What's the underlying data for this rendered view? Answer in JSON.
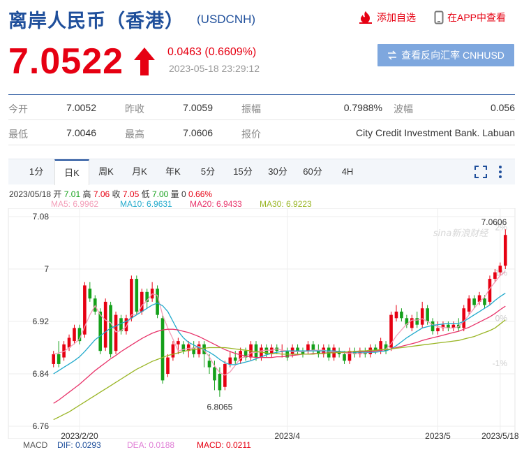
{
  "header": {
    "title": "离岸人民币（香港）",
    "code": "(USDCNH)",
    "add_label": "添加自选",
    "app_label": "在APP中查看"
  },
  "quote": {
    "price": "7.0522",
    "change": "0.0463 (0.6609%)",
    "time": "2023-05-18 23:29:12",
    "reverse_label": "查看反向汇率 CNHUSD"
  },
  "stats": {
    "row1": [
      {
        "label": "今开",
        "value": "7.0052"
      },
      {
        "label": "昨收",
        "value": "7.0059"
      },
      {
        "label": "振幅",
        "value": "0.7988%"
      },
      {
        "label": "波幅",
        "value": "0.056"
      }
    ],
    "row2": [
      {
        "label": "最低",
        "value": "7.0046"
      },
      {
        "label": "最高",
        "value": "7.0606"
      },
      {
        "label": "报价",
        "value": "City Credit Investment Bank. Labuan"
      }
    ]
  },
  "tabs": [
    "1分",
    "日K",
    "周K",
    "月K",
    "年K",
    "5分",
    "15分",
    "30分",
    "60分",
    "4H"
  ],
  "active_tab": 1,
  "info_line": {
    "date": "2023/05/18",
    "open": {
      "label": "开",
      "value": "7.01"
    },
    "high": {
      "label": "高",
      "value": "7.06"
    },
    "close": {
      "label": "收",
      "value": "7.05"
    },
    "low": {
      "label": "低",
      "value": "7.00"
    },
    "volume": {
      "label": "量",
      "value": "0"
    },
    "pct": "0.66%"
  },
  "ma_legend": [
    {
      "label": "MA5: 6.9962",
      "color": "#f39eb8"
    },
    {
      "label": "MA10: 6.9631",
      "color": "#22aacc"
    },
    {
      "label": "MA20: 6.9433",
      "color": "#e8336a"
    },
    {
      "label": "MA30: 6.9223",
      "color": "#99b524"
    }
  ],
  "macd": {
    "title": "MACD",
    "dif": "DIF: 0.0293",
    "dea": "DEA: 0.0188",
    "macd": "MACD: 0.0211"
  },
  "watermark": "sina新浪财经",
  "colors": {
    "up": "#e60012",
    "down": "#14a01a",
    "brand": "#1f4f9b"
  },
  "chart_data": {
    "type": "candlestick",
    "ylim": [
      6.76,
      7.08
    ],
    "y_ticks": [
      "7.08",
      "7",
      "6.92",
      "6.84",
      "6.76"
    ],
    "y_tick_values": [
      7.08,
      7.0,
      6.92,
      6.84,
      6.76
    ],
    "pct_ticks": [
      "2%",
      "1%",
      "0%",
      "-1%"
    ],
    "pct_tick_values": [
      2,
      1,
      0,
      -1
    ],
    "pct_base": 6.925,
    "x_ticks": [
      {
        "label": "2023/2/20",
        "index": 5
      },
      {
        "label": "2023/4",
        "index": 45
      },
      {
        "label": "2023/5",
        "index": 74
      },
      {
        "label": "2023/5/18",
        "index": 86
      }
    ],
    "annotations": [
      {
        "text": "7.0606",
        "index": 87,
        "value": 7.0606
      },
      {
        "text": "6.8065",
        "index": 32,
        "value": 6.8065
      }
    ],
    "candles": [
      [
        6.855,
        6.87,
        6.85,
        6.875
      ],
      [
        6.87,
        6.855,
        6.85,
        6.89
      ],
      [
        6.865,
        6.885,
        6.86,
        6.89
      ],
      [
        6.88,
        6.895,
        6.875,
        6.9
      ],
      [
        6.89,
        6.91,
        6.885,
        6.915
      ],
      [
        6.91,
        6.89,
        6.885,
        6.915
      ],
      [
        6.9,
        6.975,
        6.895,
        6.98
      ],
      [
        6.97,
        6.955,
        6.95,
        6.98
      ],
      [
        6.955,
        6.935,
        6.93,
        6.96
      ],
      [
        6.935,
        6.875,
        6.87,
        6.94
      ],
      [
        6.88,
        6.95,
        6.875,
        6.955
      ],
      [
        6.945,
        6.87,
        6.865,
        6.95
      ],
      [
        6.875,
        6.93,
        6.87,
        6.935
      ],
      [
        6.925,
        6.905,
        6.9,
        6.93
      ],
      [
        6.905,
        6.925,
        6.9,
        6.93
      ],
      [
        6.925,
        6.985,
        6.92,
        6.99
      ],
      [
        6.985,
        6.935,
        6.93,
        6.99
      ],
      [
        6.935,
        6.965,
        6.93,
        6.97
      ],
      [
        6.965,
        6.95,
        6.94,
        6.97
      ],
      [
        6.955,
        6.97,
        6.95,
        6.98
      ],
      [
        6.97,
        6.93,
        6.925,
        6.975
      ],
      [
        6.925,
        6.83,
        6.825,
        6.93
      ],
      [
        6.84,
        6.865,
        6.835,
        6.87
      ],
      [
        6.865,
        6.885,
        6.86,
        6.89
      ],
      [
        6.885,
        6.89,
        6.87,
        6.895
      ],
      [
        6.885,
        6.875,
        6.87,
        6.89
      ],
      [
        6.875,
        6.885,
        6.865,
        6.89
      ],
      [
        6.88,
        6.87,
        6.865,
        6.89
      ],
      [
        6.87,
        6.885,
        6.865,
        6.89
      ],
      [
        6.885,
        6.87,
        6.85,
        6.89
      ],
      [
        6.86,
        6.85,
        6.84,
        6.87
      ],
      [
        6.85,
        6.83,
        6.815,
        6.86
      ],
      [
        6.84,
        6.815,
        6.805,
        6.85
      ],
      [
        6.82,
        6.855,
        6.815,
        6.86
      ],
      [
        6.855,
        6.865,
        6.85,
        6.875
      ],
      [
        6.865,
        6.86,
        6.855,
        6.875
      ],
      [
        6.86,
        6.875,
        6.855,
        6.88
      ],
      [
        6.875,
        6.865,
        6.86,
        6.88
      ],
      [
        6.865,
        6.885,
        6.86,
        6.89
      ],
      [
        6.885,
        6.865,
        6.86,
        6.89
      ],
      [
        6.865,
        6.88,
        6.86,
        6.885
      ],
      [
        6.88,
        6.87,
        6.865,
        6.885
      ],
      [
        6.87,
        6.88,
        6.865,
        6.885
      ],
      [
        6.88,
        6.875,
        6.87,
        6.885
      ],
      [
        6.875,
        6.875,
        6.865,
        6.885
      ],
      [
        6.875,
        6.865,
        6.86,
        6.88
      ],
      [
        6.87,
        6.88,
        6.865,
        6.885
      ],
      [
        6.88,
        6.875,
        6.87,
        6.885
      ],
      [
        6.875,
        6.87,
        6.865,
        6.88
      ],
      [
        6.875,
        6.885,
        6.87,
        6.89
      ],
      [
        6.885,
        6.875,
        6.87,
        6.89
      ],
      [
        6.875,
        6.87,
        6.865,
        6.885
      ],
      [
        6.87,
        6.88,
        6.865,
        6.885
      ],
      [
        6.88,
        6.865,
        6.86,
        6.885
      ],
      [
        6.865,
        6.88,
        6.86,
        6.885
      ],
      [
        6.875,
        6.87,
        6.865,
        6.88
      ],
      [
        6.87,
        6.86,
        6.855,
        6.875
      ],
      [
        6.86,
        6.875,
        6.855,
        6.88
      ],
      [
        6.875,
        6.87,
        6.865,
        6.88
      ],
      [
        6.87,
        6.875,
        6.865,
        6.88
      ],
      [
        6.875,
        6.87,
        6.865,
        6.88
      ],
      [
        6.87,
        6.88,
        6.865,
        6.885
      ],
      [
        6.88,
        6.875,
        6.87,
        6.885
      ],
      [
        6.875,
        6.89,
        6.87,
        6.895
      ],
      [
        6.885,
        6.875,
        6.87,
        6.89
      ],
      [
        6.88,
        6.93,
        6.875,
        6.935
      ],
      [
        6.925,
        6.935,
        6.92,
        6.945
      ],
      [
        6.935,
        6.925,
        6.92,
        6.94
      ],
      [
        6.925,
        6.915,
        6.91,
        6.93
      ],
      [
        6.91,
        6.925,
        6.905,
        6.93
      ],
      [
        6.925,
        6.915,
        6.91,
        6.935
      ],
      [
        6.915,
        6.94,
        6.91,
        6.95
      ],
      [
        6.94,
        6.92,
        6.915,
        6.945
      ],
      [
        6.92,
        6.905,
        6.9,
        6.925
      ],
      [
        6.905,
        6.91,
        6.9,
        6.92
      ],
      [
        6.91,
        6.915,
        6.905,
        6.92
      ],
      [
        6.915,
        6.91,
        6.905,
        6.92
      ],
      [
        6.91,
        6.915,
        6.905,
        6.92
      ],
      [
        6.915,
        6.91,
        6.905,
        6.925
      ],
      [
        6.91,
        6.94,
        6.905,
        6.945
      ],
      [
        6.935,
        6.955,
        6.93,
        6.96
      ],
      [
        6.955,
        6.945,
        6.94,
        6.96
      ],
      [
        6.95,
        6.96,
        6.945,
        6.965
      ],
      [
        6.955,
        6.945,
        6.94,
        6.96
      ],
      [
        6.95,
        6.985,
        6.945,
        6.99
      ],
      [
        6.985,
        6.995,
        6.98,
        7.0
      ],
      [
        6.995,
        7.005,
        6.99,
        7.01
      ],
      [
        7.005,
        7.052,
        7.0,
        7.0606
      ]
    ],
    "ma": {
      "MA5": [
        6.87,
        6.872,
        6.874,
        6.88,
        6.886,
        6.893,
        6.912,
        6.93,
        6.944,
        6.93,
        6.922,
        6.918,
        6.904,
        6.906,
        6.912,
        6.93,
        6.93,
        6.944,
        6.952,
        6.962,
        6.96,
        6.93,
        6.91,
        6.893,
        6.875,
        6.877,
        6.879,
        6.879,
        6.882,
        6.876,
        6.866,
        6.852,
        6.842,
        6.838,
        6.843,
        6.853,
        6.864,
        6.866,
        6.872,
        6.873,
        6.875,
        6.876,
        6.876,
        6.878,
        6.876,
        6.875,
        6.874,
        6.874,
        6.874,
        6.875,
        6.876,
        6.876,
        6.876,
        6.874,
        6.874,
        6.873,
        6.872,
        6.871,
        6.871,
        6.871,
        6.872,
        6.873,
        6.874,
        6.876,
        6.878,
        6.886,
        6.898,
        6.907,
        6.916,
        6.922,
        6.922,
        6.924,
        6.92,
        6.915,
        6.912,
        6.911,
        6.91,
        6.91,
        6.912,
        6.92,
        6.93,
        6.94,
        6.95,
        6.957,
        6.97,
        6.98,
        6.99,
        6.9962
      ],
      "MA10": [
        6.84,
        6.845,
        6.85,
        6.855,
        6.86,
        6.866,
        6.874,
        6.883,
        6.892,
        6.898,
        6.904,
        6.91,
        6.913,
        6.917,
        6.92,
        6.925,
        6.93,
        6.935,
        6.94,
        6.945,
        6.948,
        6.944,
        6.935,
        6.92,
        6.905,
        6.895,
        6.888,
        6.884,
        6.88,
        6.877,
        6.873,
        6.868,
        6.862,
        6.857,
        6.854,
        6.854,
        6.856,
        6.858,
        6.86,
        6.863,
        6.866,
        6.869,
        6.871,
        6.873,
        6.874,
        6.875,
        6.875,
        6.875,
        6.875,
        6.875,
        6.875,
        6.875,
        6.875,
        6.875,
        6.875,
        6.874,
        6.874,
        6.873,
        6.873,
        6.873,
        6.873,
        6.873,
        6.873,
        6.874,
        6.875,
        6.878,
        6.883,
        6.889,
        6.895,
        6.9,
        6.905,
        6.91,
        6.912,
        6.914,
        6.915,
        6.916,
        6.917,
        6.917,
        6.917,
        6.92,
        6.925,
        6.93,
        6.935,
        6.94,
        6.945,
        6.952,
        6.958,
        6.9631
      ],
      "MA20": [
        6.795,
        6.8,
        6.806,
        6.812,
        6.818,
        6.824,
        6.831,
        6.838,
        6.845,
        6.851,
        6.857,
        6.863,
        6.868,
        6.874,
        6.879,
        6.884,
        6.889,
        6.894,
        6.898,
        6.902,
        6.905,
        6.907,
        6.908,
        6.908,
        6.907,
        6.905,
        6.903,
        6.9,
        6.897,
        6.893,
        6.889,
        6.885,
        6.881,
        6.877,
        6.874,
        6.871,
        6.869,
        6.867,
        6.866,
        6.865,
        6.865,
        6.865,
        6.865,
        6.866,
        6.866,
        6.867,
        6.868,
        6.869,
        6.87,
        6.87,
        6.871,
        6.871,
        6.872,
        6.872,
        6.873,
        6.873,
        6.873,
        6.873,
        6.874,
        6.874,
        6.874,
        6.874,
        6.875,
        6.876,
        6.877,
        6.878,
        6.88,
        6.882,
        6.884,
        6.886,
        6.888,
        6.891,
        6.893,
        6.895,
        6.897,
        6.899,
        6.901,
        6.903,
        6.905,
        6.908,
        6.911,
        6.915,
        6.919,
        6.923,
        6.927,
        6.932,
        6.938,
        6.9433
      ],
      "MA30": [
        6.77,
        6.774,
        6.778,
        6.782,
        6.787,
        6.792,
        6.797,
        6.802,
        6.807,
        6.812,
        6.817,
        6.822,
        6.827,
        6.832,
        6.837,
        6.842,
        6.847,
        6.851,
        6.855,
        6.859,
        6.862,
        6.865,
        6.868,
        6.87,
        6.872,
        6.874,
        6.876,
        6.877,
        6.878,
        6.879,
        6.88,
        6.88,
        6.88,
        6.88,
        6.879,
        6.878,
        6.877,
        6.876,
        6.875,
        6.874,
        6.873,
        6.872,
        6.871,
        6.871,
        6.87,
        6.87,
        6.87,
        6.87,
        6.87,
        6.87,
        6.87,
        6.871,
        6.871,
        6.872,
        6.872,
        6.873,
        6.873,
        6.874,
        6.874,
        6.875,
        6.875,
        6.876,
        6.876,
        6.877,
        6.877,
        6.878,
        6.879,
        6.88,
        6.881,
        6.882,
        6.883,
        6.884,
        6.885,
        6.886,
        6.887,
        6.888,
        6.889,
        6.89,
        6.891,
        6.893,
        6.895,
        6.897,
        6.9,
        6.903,
        6.906,
        6.91,
        6.916,
        6.9223
      ]
    }
  }
}
